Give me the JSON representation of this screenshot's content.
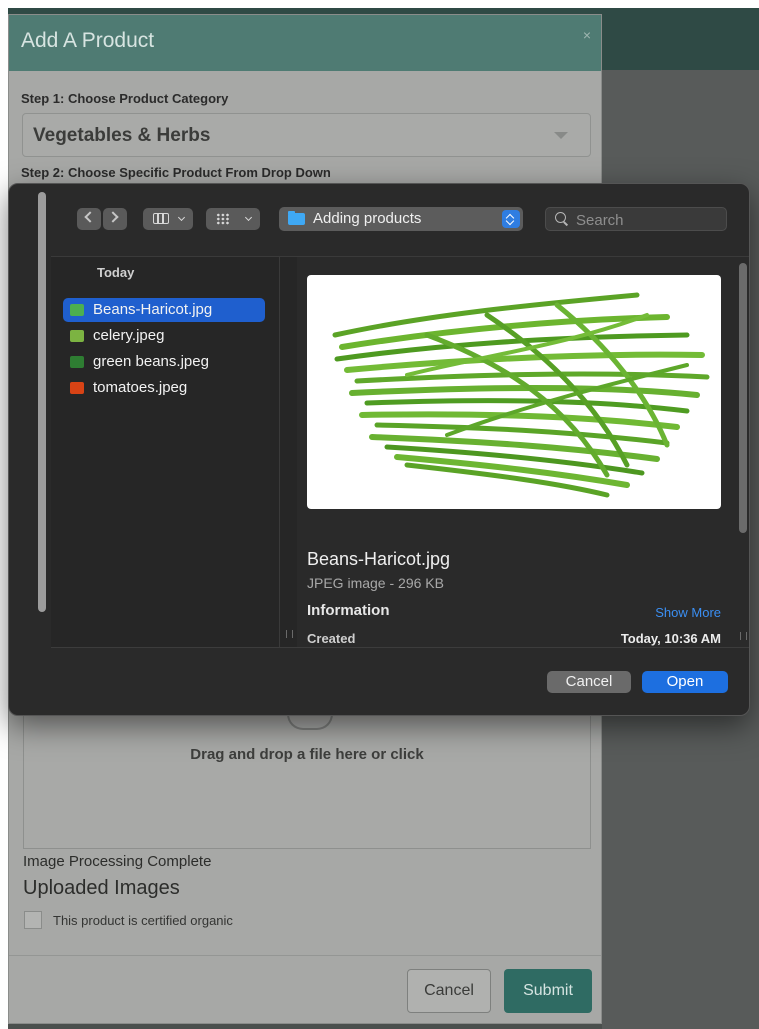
{
  "modal": {
    "title": "Add A Product",
    "close": "×",
    "step1_label": "Step 1: Choose Product Category",
    "category_value": "Vegetables & Herbs",
    "step2_label": "Step 2: Choose Specific Product From Drop Down",
    "dropzone_text": "Drag and drop a file here or click",
    "processing_text": "Image Processing Complete",
    "uploaded_title": "Uploaded Images",
    "organic_label": "This product is certified organic",
    "cancel_label": "Cancel",
    "submit_label": "Submit"
  },
  "dialog": {
    "location": "Adding products",
    "search_placeholder": "Search",
    "sidebar_heading": "Today",
    "files": [
      {
        "name": "Beans-Haricot.jpg",
        "selected": true,
        "icon_color": "#4caf50"
      },
      {
        "name": "celery.jpeg",
        "selected": false,
        "icon_color": "#7cb342"
      },
      {
        "name": "green beans.jpeg",
        "selected": false,
        "icon_color": "#2e7d32"
      },
      {
        "name": "tomatoes.jpeg",
        "selected": false,
        "icon_color": "#d84315"
      }
    ],
    "preview": {
      "filename": "Beans-Haricot.jpg",
      "kind": "JPEG image - 296 KB",
      "info_heading": "Information",
      "show_more": "Show More",
      "created_label": "Created",
      "created_value": "Today, 10:36 AM"
    },
    "cancel_label": "Cancel",
    "open_label": "Open"
  },
  "colors": {
    "modal_header": "#4f7b73",
    "submit": "#2f6b63",
    "accent_blue": "#1d6fe0",
    "folder_blue": "#3fa9f5",
    "bean_green": "#6cb52f"
  }
}
